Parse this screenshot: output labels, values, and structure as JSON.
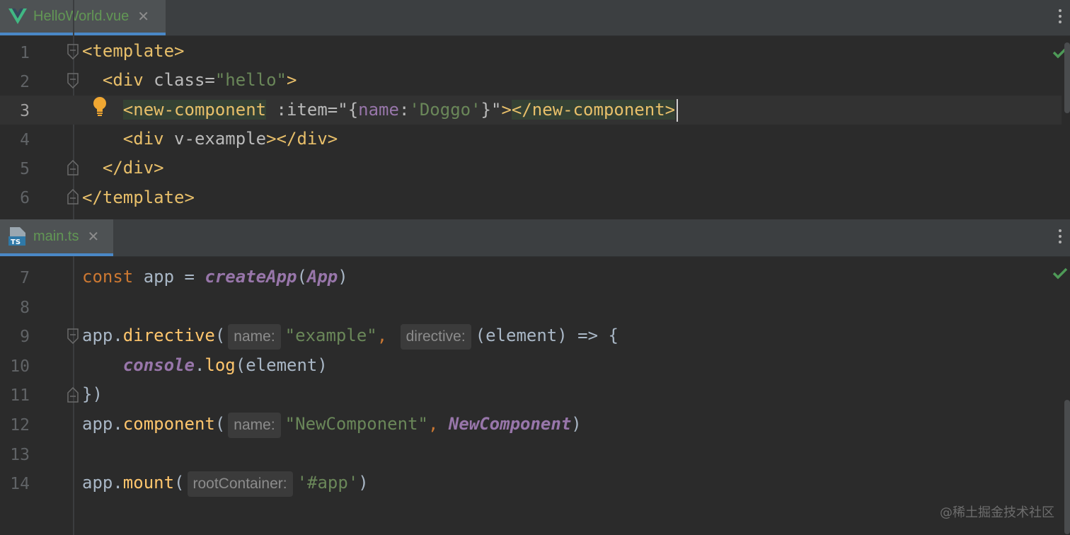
{
  "editor_top": {
    "tab": {
      "filename": "HelloWorld.vue",
      "icon": "vue-icon"
    },
    "current_line": 3,
    "lines": [
      {
        "num": "1"
      },
      {
        "num": "2"
      },
      {
        "num": "3"
      },
      {
        "num": "4"
      },
      {
        "num": "5"
      },
      {
        "num": "6"
      }
    ],
    "code": {
      "l1": "<template>",
      "l2_tag_open": "<div ",
      "l2_attr": "class=",
      "l2_str": "\"hello\"",
      "l2_tag_close": ">",
      "l3_tag": "<new-component",
      "l3_attr": " :item=\"{",
      "l3_key": "name",
      "l3_colon": ":",
      "l3_str": "'Doggo'",
      "l3_brace": "}\"",
      "l3_close": ">",
      "l3_end_tag": "</new-component>",
      "l4_tag_open": "<div ",
      "l4_attr": "v-example",
      "l4_tag_close": "></div>",
      "l5": "</div>",
      "l6": "</template>"
    }
  },
  "editor_bottom": {
    "tab": {
      "filename": "main.ts",
      "icon": "typescript-icon",
      "icon_text": "TS"
    },
    "lines": [
      {
        "num": "7"
      },
      {
        "num": "8"
      },
      {
        "num": "9"
      },
      {
        "num": "10"
      },
      {
        "num": "11"
      },
      {
        "num": "12"
      },
      {
        "num": "13"
      },
      {
        "num": "14"
      }
    ],
    "code": {
      "l7_kw": "const",
      "l7_rest": " app = ",
      "l7_fn": "createApp",
      "l7_arg": "App",
      "l7_open": "(",
      "l7_close": ")",
      "l9_obj": "app.",
      "l9_fn": "directive",
      "l9_open": "(",
      "l9_hint1": "name:",
      "l9_str": "\"example\"",
      "l9_comma": ",",
      "l9_hint2": "directive:",
      "l9_rest": "(element) => {",
      "l10_obj": "console",
      "l10_dot": ".",
      "l10_fn": "log",
      "l10_rest": "(element)",
      "l11": "})",
      "l12_obj": "app.",
      "l12_fn": "component",
      "l12_open": "(",
      "l12_hint": "name:",
      "l12_str": "\"NewComponent\"",
      "l12_comma": ", ",
      "l12_arg": "NewComponent",
      "l12_close": ")",
      "l14_obj": "app.",
      "l14_fn": "mount",
      "l14_open": "(",
      "l14_hint": "rootContainer:",
      "l14_str": "'#app'",
      "l14_close": ")"
    }
  },
  "watermark": "@稀土掘金技术社区",
  "colors": {
    "accent": "#4a88c7",
    "ok": "#4e9a57",
    "tag": "#e8bf6a",
    "string": "#6a8759",
    "keyword": "#cc7832",
    "function": "#ffc66d",
    "purple": "#9876aa"
  }
}
